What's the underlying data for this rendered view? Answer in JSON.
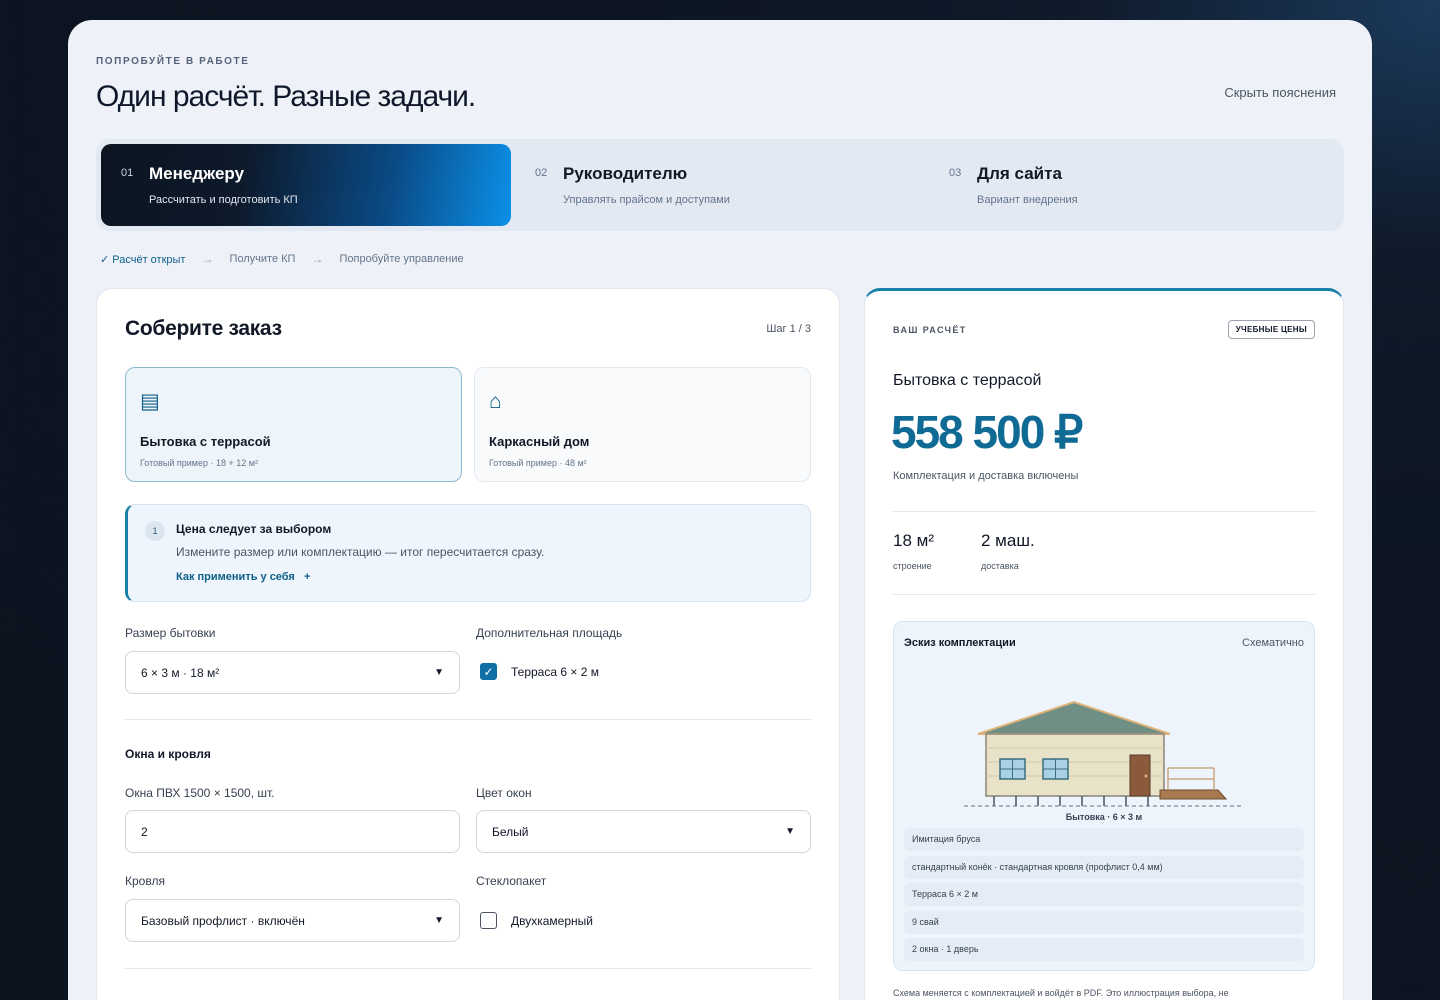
{
  "header": {
    "eyebrow": "ПОПРОБУЙТЕ В РАБОТЕ",
    "title": "Один расчёт. Разные задачи.",
    "hide_link": "Скрыть пояснения"
  },
  "tabs": [
    {
      "num": "01",
      "title": "Менеджеру",
      "sub": "Рассчитать и подготовить КП",
      "active": true
    },
    {
      "num": "02",
      "title": "Руководителю",
      "sub": "Управлять прайсом и доступами",
      "active": false
    },
    {
      "num": "03",
      "title": "Для сайта",
      "sub": "Вариант внедрения",
      "active": false
    }
  ],
  "progress": {
    "step1": "✓ Расчёт открыт",
    "arrow": "→",
    "step2": "Получите КП",
    "step3": "Попробуйте управление"
  },
  "order": {
    "title": "Соберите заказ",
    "step": "Шаг 1 / 3",
    "choices": [
      {
        "icon": "▤",
        "icon_name": "cabin-icon",
        "name": "Бытовка с террасой",
        "desc": "Готовый пример · 18 + 12 м²",
        "selected": true
      },
      {
        "icon": "⌂",
        "icon_name": "house-icon",
        "name": "Каркасный дом",
        "desc": "Готовый пример · 48 м²",
        "selected": false
      }
    ],
    "hint": {
      "badge": "1",
      "title": "Цена следует за выбором",
      "text": "Измените размер или комплектацию — итог пересчитается сразу.",
      "link": "Как применить у себя   +"
    },
    "size_label": "Размер бытовки",
    "size_value": "6 × 3 м · 18 м²",
    "extra_label": "Дополнительная площадь",
    "terrace_label": "Терраса 6 × 2 м",
    "terrace_checked": true,
    "windows_section": "Окна и кровля",
    "windows_label": "Окна ПВХ 1500 × 1500, шт.",
    "windows_value": "2",
    "window_color_label": "Цвет окон",
    "window_color_value": "Белый",
    "roof_label": "Кровля",
    "roof_value": "Базовый профлист · включён",
    "glass_label": "Стеклопакет",
    "glass_option": "Двухкамерный",
    "glass_checked": false
  },
  "summary": {
    "label": "ВАШ РАСЧЁТ",
    "badge": "УЧЕБНЫЕ ЦЕНЫ",
    "name": "Бытовка с террасой",
    "price": "558 500 ₽",
    "note": "Комплектация и доставка включены",
    "stats": [
      {
        "value": "18 м²",
        "key": "строение"
      },
      {
        "value": "2 маш.",
        "key": "доставка"
      }
    ],
    "sketch": {
      "title": "Эскиз комплектации",
      "tag": "Схематично",
      "caption": "Бытовка · 6 × 3 м",
      "items": [
        "Имитация бруса",
        "стандартный конёк · стандартная кровля (профлист 0,4 мм)",
        "Терраса 6 × 2 м",
        "9 свай",
        "2 окна · 1 дверь"
      ]
    },
    "footer": "Схема меняется с комплектацией и войдёт в PDF. Это иллюстрация выбора, не"
  },
  "colors": {
    "accent": "#0f6a94",
    "roof": "#6f8f84",
    "wall": "#e8e2c8",
    "door": "#8b5a3c",
    "window": "#a9d0e6"
  }
}
